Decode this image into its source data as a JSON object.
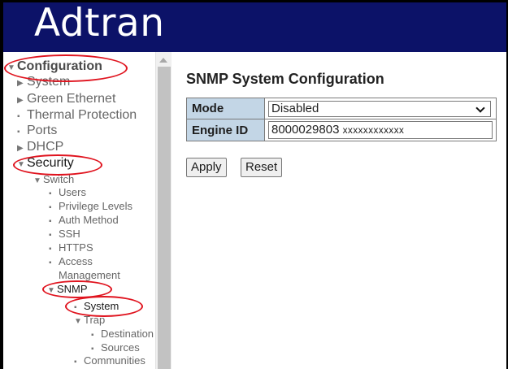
{
  "header": {
    "logo_text": "Adtran",
    "background_color": "#0c1268"
  },
  "sidebar": {
    "annotation_color": "#e0141f",
    "items": [
      {
        "label": "Configuration",
        "marker": "▼"
      },
      {
        "label": "System",
        "marker": "▶"
      },
      {
        "label": "Green Ethernet",
        "marker": "▶"
      },
      {
        "label": "Thermal Protection",
        "marker": "▪"
      },
      {
        "label": "Ports",
        "marker": "▪"
      },
      {
        "label": "DHCP",
        "marker": "▶"
      },
      {
        "label": "Security",
        "marker": "▼"
      },
      {
        "label": "Switch",
        "marker": "▼"
      },
      {
        "label": "Users",
        "marker": "▪"
      },
      {
        "label": "Privilege Levels",
        "marker": "▪"
      },
      {
        "label": "Auth Method",
        "marker": "▪"
      },
      {
        "label": "SSH",
        "marker": "▪"
      },
      {
        "label": "HTTPS",
        "marker": "▪"
      },
      {
        "label": "Access",
        "marker": "▪"
      },
      {
        "label": "Management",
        "marker": ""
      },
      {
        "label": "SNMP",
        "marker": "▼"
      },
      {
        "label": "System",
        "marker": "▪"
      },
      {
        "label": "Trap",
        "marker": "▼"
      },
      {
        "label": "Destination",
        "marker": "▪"
      },
      {
        "label": "Sources",
        "marker": "▪"
      },
      {
        "label": "Communities",
        "marker": "▪"
      }
    ]
  },
  "main": {
    "title": "SNMP System Configuration",
    "fields": {
      "mode": {
        "label": "Mode",
        "value": "Disabled"
      },
      "engine_id": {
        "label": "Engine ID",
        "value": "8000029803",
        "value_suffix": "xxxxxxxxxxxx"
      }
    },
    "label_bg_color": "#c3d6e6",
    "buttons": {
      "apply": "Apply",
      "reset": "Reset"
    }
  }
}
